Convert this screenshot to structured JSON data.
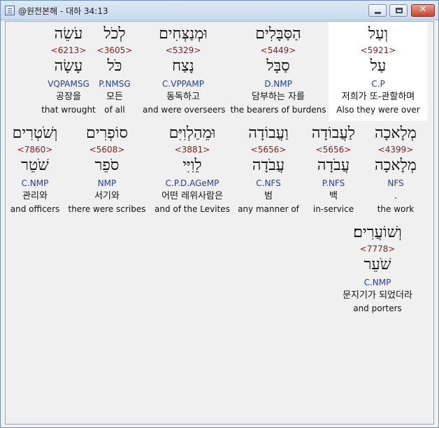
{
  "window": {
    "title": "@원전본해 - 대하 34:13",
    "close_glyph": "✕"
  },
  "rows": [
    [
      {
        "hebrew": "עֹשֵׂה",
        "strong": "<6213>",
        "lemma": "עָשָׂה",
        "morph": "VQPAMSG",
        "korean": "공장을",
        "english": "that wrought"
      },
      {
        "hebrew": "לְכֹל",
        "strong": "<3605>",
        "lemma": "כֹּל",
        "morph": "P.NMSG",
        "korean": "모든",
        "english": "of all"
      },
      {
        "hebrew": "וּמְנַצְּחִים",
        "strong": "<5329>",
        "lemma": "נָצַח",
        "morph": "C.VPPAMP",
        "korean": "동독하고",
        "english": "and were overseers"
      },
      {
        "hebrew": "הַסַּבָּלִים",
        "strong": "<5449>",
        "lemma": "סַבָּל",
        "morph": "D.NMP",
        "korean": "담부하는 자를",
        "english": "the bearers of burdens"
      },
      {
        "hebrew": "וְעַל",
        "strong": "<5921>",
        "lemma": "עַל",
        "morph": "C.P",
        "korean": "저희가 또-관할하며",
        "english": "Also they were over"
      }
    ],
    [
      {
        "hebrew": "וְשֹׁטְרִים",
        "strong": "<7860>",
        "lemma": "שֹׁטֵר",
        "morph": "C.NMP",
        "korean": "관리와",
        "english": "and officers"
      },
      {
        "hebrew": "סוֹפְרִים",
        "strong": "<5608>",
        "lemma": "סֹפֵר",
        "morph": "NMP",
        "korean": "서기와",
        "english": "there were scribes"
      },
      {
        "hebrew": "וּמֵהַלְוִיִּם",
        "strong": "<3881>",
        "lemma": "לֵוִיִּי",
        "morph": "C.P.D.AGeMP",
        "korean": "어떤 레위사람은",
        "english": "and of the Levites"
      },
      {
        "hebrew": "וַעֲבוֹדָה",
        "strong": "<5656>",
        "lemma": "עֲבֹדָה",
        "morph": "C.NFS",
        "korean": "범",
        "english": "any manner of"
      },
      {
        "hebrew": "לַעֲבוֹדָה",
        "strong": "<5656>",
        "lemma": "עֲבֹדָה",
        "morph": "P.NFS",
        "korean": "백",
        "english": "in-service"
      },
      {
        "hebrew": "מְלָאכָה",
        "strong": "<4399>",
        "lemma": "מְלָאכָה",
        "morph": "NFS",
        "korean": ".",
        "english": "the work"
      }
    ],
    [
      {
        "hebrew": "וְשׁוֹעֲרִים׃",
        "strong": "<7778>",
        "lemma": "שֹׁעֵר",
        "morph": "C.NMP",
        "korean": "문지기가 되었더라",
        "english": "and porters"
      }
    ]
  ]
}
